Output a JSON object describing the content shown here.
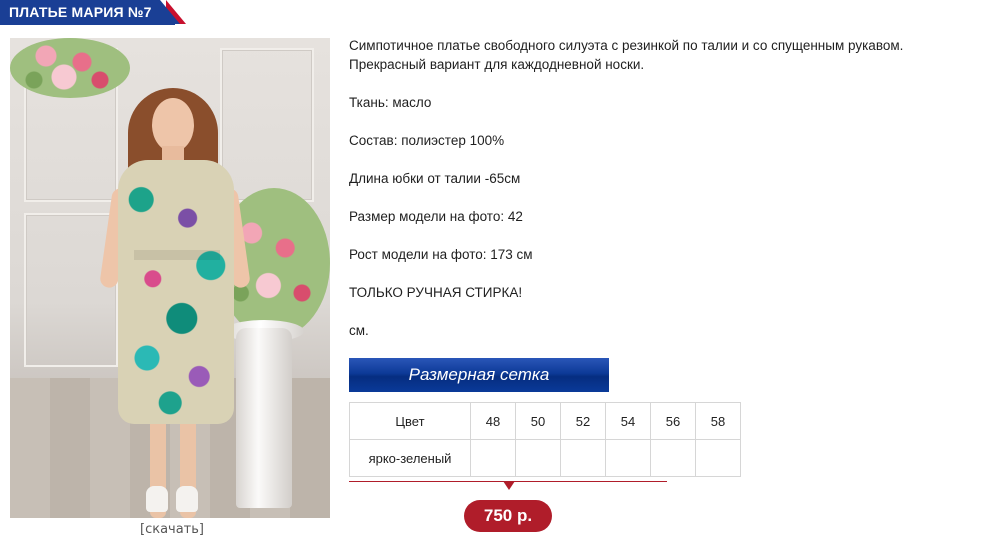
{
  "product": {
    "title": "ПЛАТЬЕ МАРИЯ №7",
    "download_label": "[скачать]"
  },
  "description": {
    "lines": [
      "Симпотичное платье свободного силуэта с резинкой по талии и со спущенным рукавом.",
      "Прекрасный вариант для каждодневной носки.",
      "Ткань: масло",
      "Состав: полиэстер 100%",
      "Длина юбки от талии -65см",
      "Размер модели на фото: 42",
      "Рост модели на фото: 173 см",
      "ТОЛЬКО РУЧНАЯ СТИРКА!",
      "см."
    ]
  },
  "size_grid": {
    "button_label": "Размерная сетка",
    "color_header": "Цвет",
    "sizes": [
      "48",
      "50",
      "52",
      "54",
      "56",
      "58"
    ],
    "rows": [
      {
        "color": "ярко-зеленый"
      }
    ]
  },
  "price": {
    "label": "750 р."
  },
  "colors": {
    "brand_blue": "#1a3f95",
    "accent_red": "#b01d2a"
  }
}
